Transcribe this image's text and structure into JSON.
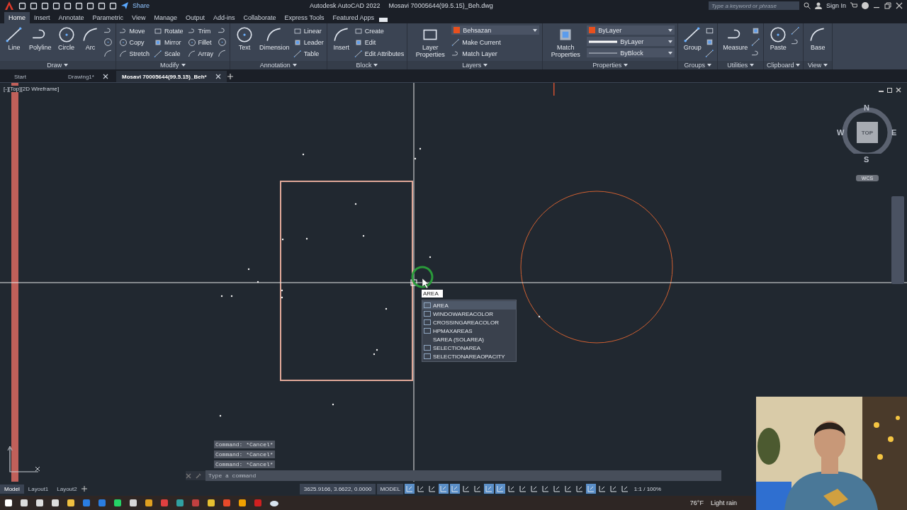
{
  "title_bar": {
    "share": "Share",
    "app_title": "Autodesk AutoCAD 2022",
    "file_title": "Mosavi 70005644(99.5.15)_Beh.dwg",
    "search": {
      "placeholder": "Type a keyword or phrase"
    },
    "sign_in": "Sign In"
  },
  "ribbon_tabs": [
    {
      "label": "Home",
      "selected": true
    },
    {
      "label": "Insert",
      "selected": false
    },
    {
      "label": "Annotate",
      "selected": false
    },
    {
      "label": "Parametric",
      "selected": false
    },
    {
      "label": "View",
      "selected": false
    },
    {
      "label": "Manage",
      "selected": false
    },
    {
      "label": "Output",
      "selected": false
    },
    {
      "label": "Add-ins",
      "selected": false
    },
    {
      "label": "Collaborate",
      "selected": false
    },
    {
      "label": "Express Tools",
      "selected": false
    },
    {
      "label": "Featured Apps",
      "selected": false
    }
  ],
  "ribbon_panels": [
    {
      "title": "Draw",
      "tools": [
        {
          "kind": "large",
          "label": "Line"
        },
        {
          "kind": "large",
          "label": "Polyline"
        },
        {
          "kind": "large",
          "label": "Circle"
        },
        {
          "kind": "large",
          "label": "Arc"
        },
        {
          "kind": "icon"
        },
        {
          "kind": "icon"
        },
        {
          "kind": "icon"
        }
      ]
    },
    {
      "title": "Modify",
      "tools": [
        {
          "kind": "small",
          "label": "Move"
        },
        {
          "kind": "small",
          "label": "Copy"
        },
        {
          "kind": "small",
          "label": "Stretch"
        },
        {
          "kind": "small",
          "label": "Rotate"
        },
        {
          "kind": "small",
          "label": "Mirror"
        },
        {
          "kind": "small",
          "label": "Scale"
        },
        {
          "kind": "small",
          "label": "Trim"
        },
        {
          "kind": "small",
          "label": "Fillet"
        },
        {
          "kind": "small",
          "label": "Array"
        },
        {
          "kind": "icon"
        },
        {
          "kind": "icon"
        },
        {
          "kind": "icon"
        }
      ]
    },
    {
      "title": "Annotation",
      "tools": [
        {
          "kind": "large",
          "label": "Text"
        },
        {
          "kind": "large",
          "label": "Dimension"
        },
        {
          "kind": "small",
          "label": "Linear"
        },
        {
          "kind": "small",
          "label": "Leader"
        },
        {
          "kind": "small",
          "label": "Table"
        }
      ]
    },
    {
      "title": "Block",
      "tools": [
        {
          "kind": "large",
          "label": "Insert"
        },
        {
          "kind": "small",
          "label": "Create"
        },
        {
          "kind": "small",
          "label": "Edit"
        },
        {
          "kind": "small",
          "label": "Edit Attributes"
        }
      ]
    },
    {
      "title": "Layers",
      "tools": [
        {
          "kind": "large",
          "label": "Layer Properties"
        },
        {
          "kind": "color-dropdown",
          "label": "Behsazan",
          "color": "#e8501e"
        },
        {
          "kind": "small",
          "label": "Make Current"
        },
        {
          "kind": "small",
          "label": "Match Layer"
        }
      ]
    },
    {
      "title": "Properties",
      "tools": [
        {
          "kind": "large",
          "label": "Match Properties"
        },
        {
          "kind": "color-dropdown",
          "label": "ByLayer",
          "color": "#e8501e"
        },
        {
          "kind": "lineweight-dropdown",
          "label": "ByLayer"
        },
        {
          "kind": "linetype-dropdown",
          "label": "ByBlock"
        }
      ]
    },
    {
      "title": "Groups",
      "tools": [
        {
          "kind": "large",
          "label": "Group"
        },
        {
          "kind": "icon"
        },
        {
          "kind": "icon"
        },
        {
          "kind": "icon"
        }
      ]
    },
    {
      "title": "Utilities",
      "tools": [
        {
          "kind": "large",
          "label": "Measure"
        },
        {
          "kind": "icon"
        },
        {
          "kind": "icon"
        },
        {
          "kind": "icon"
        }
      ]
    },
    {
      "title": "Clipboard",
      "tools": [
        {
          "kind": "large",
          "label": "Paste"
        },
        {
          "kind": "icon"
        },
        {
          "kind": "icon"
        }
      ]
    },
    {
      "title": "View",
      "tools": [
        {
          "kind": "large",
          "label": "Base"
        }
      ]
    }
  ],
  "doc_tabs": [
    {
      "label": "Start",
      "selected": false,
      "closable": false
    },
    {
      "label": "Drawing1*",
      "selected": false,
      "closable": true
    },
    {
      "label": "Mosavi 70005644(99.5.15)_Beh*",
      "selected": true,
      "closable": true
    }
  ],
  "viewport": {
    "label": "[-][Top][2D Wireframe]",
    "viewcube": {
      "north": "N",
      "south": "S",
      "east": "E",
      "west": "W",
      "face": "TOP",
      "ucs": "WCS"
    }
  },
  "autocomplete": {
    "input": "AREA",
    "items": [
      {
        "label": "AREA",
        "kind": "command",
        "selected": true
      },
      {
        "label": "WINDOWAREACOLOR",
        "kind": "command",
        "selected": false
      },
      {
        "label": "CROSSINGAREACOLOR",
        "kind": "command",
        "selected": false
      },
      {
        "label": "HPMAXAREAS",
        "kind": "command",
        "selected": false
      },
      {
        "label": "SAREA (SOLAREA)",
        "kind": "alias",
        "selected": false
      },
      {
        "label": "SELECTIONAREA",
        "kind": "command",
        "selected": false
      },
      {
        "label": "SELECTIONAREAOPACITY",
        "kind": "command",
        "selected": false
      }
    ]
  },
  "command_history": [
    "Command: *Cancel*",
    "Command: *Cancel*",
    "Command: *Cancel*"
  ],
  "command_line": {
    "placeholder": "Type a command"
  },
  "layout_tabs": [
    {
      "label": "Model",
      "selected": true
    },
    {
      "label": "Layout1",
      "selected": false
    },
    {
      "label": "Layout2",
      "selected": false
    }
  ],
  "status_bar": {
    "coordinates": "3625.9166, 3.6622, 0.0000",
    "space": "MODEL",
    "scale": "1:1 / 100%",
    "toggles": [
      {
        "on": true
      },
      {
        "on": false
      },
      {
        "on": false
      },
      {
        "on": true
      },
      {
        "on": true
      },
      {
        "on": false
      },
      {
        "on": false
      },
      {
        "on": true
      },
      {
        "on": true
      },
      {
        "on": false
      },
      {
        "on": false
      },
      {
        "on": false
      },
      {
        "on": false
      },
      {
        "on": false
      },
      {
        "on": false
      },
      {
        "on": false
      },
      {
        "on": true
      },
      {
        "on": false
      },
      {
        "on": false
      },
      {
        "on": false
      }
    ]
  },
  "taskbar": {
    "temperature": "76°F",
    "weather": "Light rain"
  },
  "webcam": {
    "kind": "picture"
  }
}
